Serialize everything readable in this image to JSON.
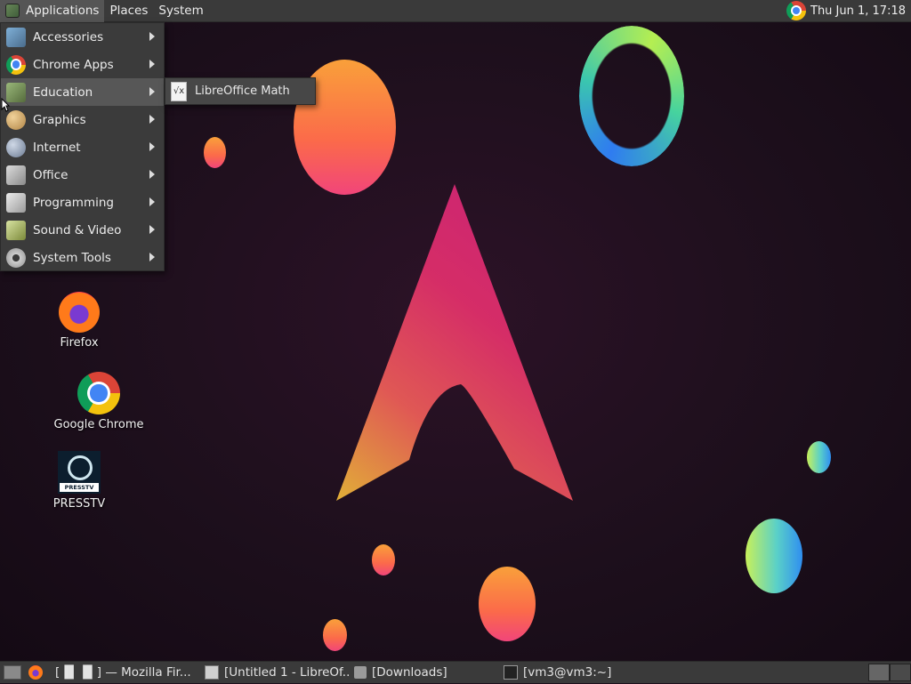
{
  "top_panel": {
    "menus": [
      {
        "label": "Applications",
        "icon": "gnome-foot-icon"
      },
      {
        "label": "Places"
      },
      {
        "label": "System"
      }
    ],
    "clock": "Thu Jun  1, 17:18"
  },
  "app_menu": {
    "items": [
      {
        "label": "Accessories",
        "icon": "accessories-icon"
      },
      {
        "label": "Chrome Apps",
        "icon": "chrome-icon"
      },
      {
        "label": "Education",
        "icon": "education-icon",
        "hovered": true
      },
      {
        "label": "Graphics",
        "icon": "graphics-icon"
      },
      {
        "label": "Internet",
        "icon": "internet-icon"
      },
      {
        "label": "Office",
        "icon": "office-icon"
      },
      {
        "label": "Programming",
        "icon": "programming-icon"
      },
      {
        "label": "Sound & Video",
        "icon": "sound-video-icon"
      },
      {
        "label": "System Tools",
        "icon": "system-tools-icon"
      }
    ],
    "submenu": {
      "items": [
        {
          "label": "LibreOffice Math",
          "icon": "libreoffice-math-icon",
          "glyph": "√x"
        }
      ]
    }
  },
  "desktop_icons": [
    {
      "label": "Firefox",
      "icon": "firefox-icon"
    },
    {
      "label": "Google Chrome",
      "icon": "chrome-icon"
    },
    {
      "label": "PRESSTV",
      "icon": "presstv-icon",
      "logo_text": "PRESSTV"
    }
  ],
  "taskbar": {
    "tasks": [
      {
        "label": "[▐▌▐▌] — Mozilla Fir...",
        "icon": "firefox-icon"
      },
      {
        "label": "[Untitled 1 - LibreOf...",
        "icon": "document-icon"
      },
      {
        "label": "[Downloads]",
        "icon": "folder-icon"
      },
      {
        "label": "[vm3@vm3:~]",
        "icon": "terminal-icon"
      }
    ],
    "workspaces": 2
  },
  "colors": {
    "panel_bg": "#3a3a3a",
    "menu_bg": "#3b3b3b",
    "menu_hover": "#575757",
    "desktop_bg": "#1d0f1b"
  }
}
